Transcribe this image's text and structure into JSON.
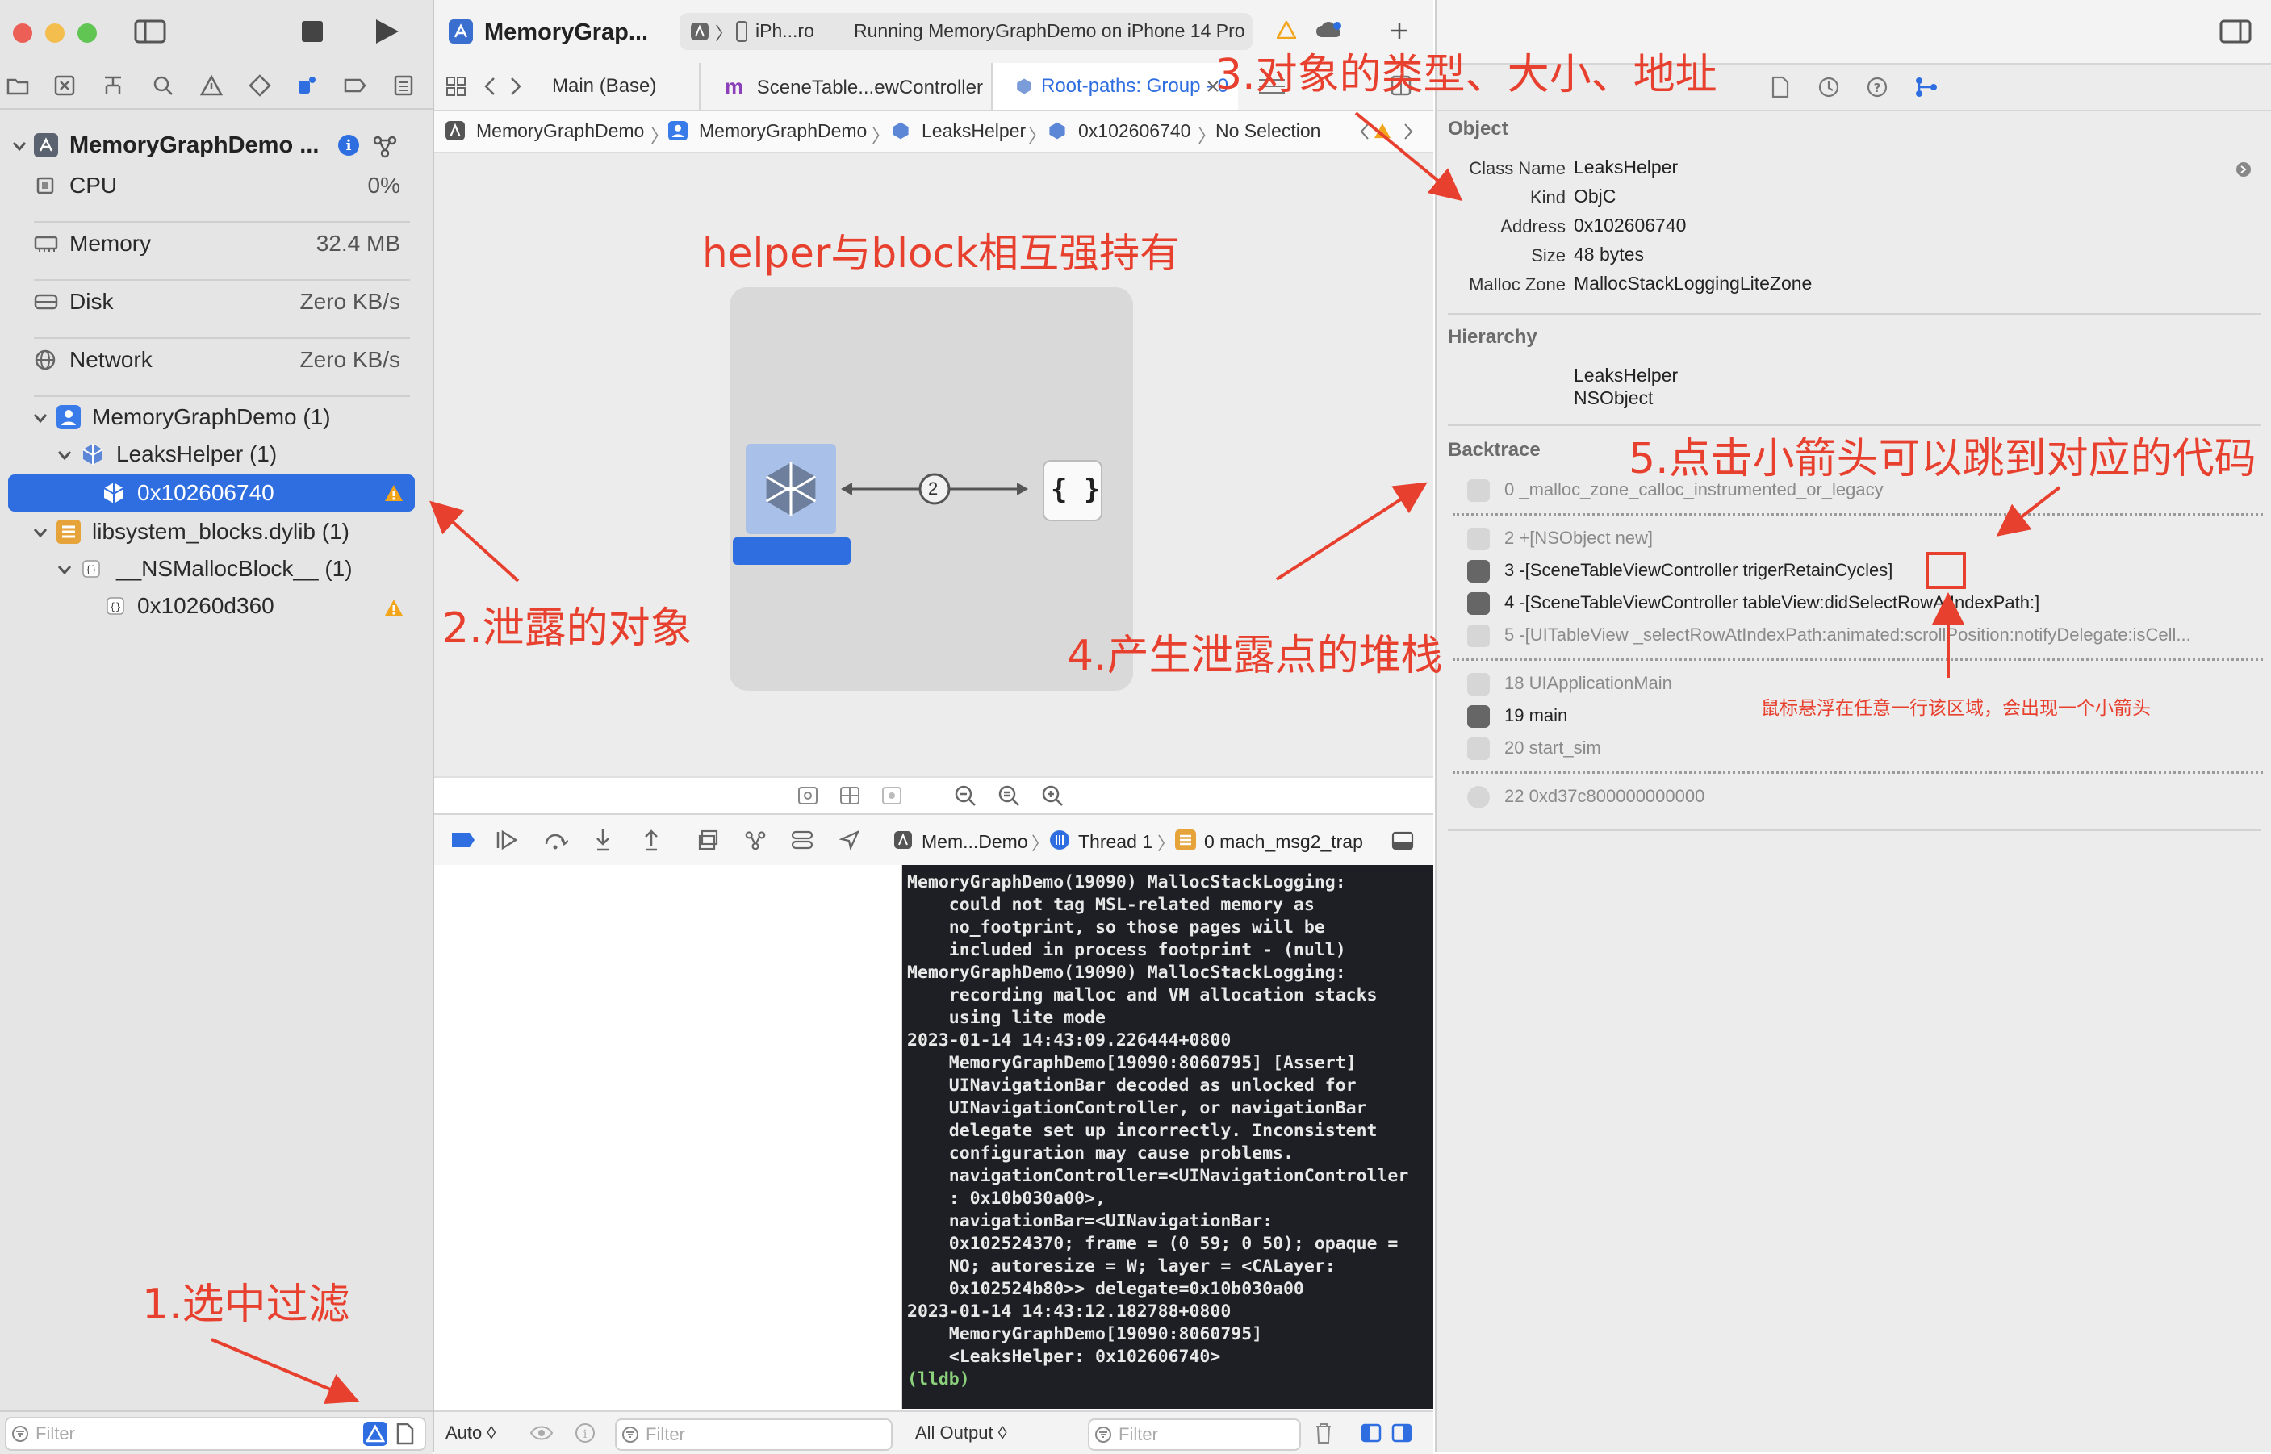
{
  "navigator": {
    "resources": [
      {
        "label": "CPU",
        "value": "0%"
      },
      {
        "label": "Memory",
        "value": "32.4 MB"
      },
      {
        "label": "Disk",
        "value": "Zero KB/s"
      },
      {
        "label": "Network",
        "value": "Zero KB/s"
      }
    ],
    "process_title": "MemoryGraphDemo ...",
    "tree": {
      "app": "MemoryGraphDemo (1)",
      "class": "LeaksHelper (1)",
      "selected": "0x102606740",
      "lib": "libsystem_blocks.dylib (1)",
      "block_class": "__NSMallocBlock__ (1)",
      "block_addr": "0x10260d360"
    },
    "filter_placeholder": "Filter"
  },
  "toolbar": {
    "scheme": "MemoryGrap...",
    "destination": "iPh...ro",
    "status": "Running MemoryGraphDemo on iPhone 14 Pro"
  },
  "tabs": [
    {
      "label": "Main (Base)"
    },
    {
      "label": "SceneTable...ewController",
      "prefix": "m"
    },
    {
      "label": "Root-paths: Group - 0"
    }
  ],
  "jumpbar": [
    "MemoryGraphDemo",
    "MemoryGraphDemo",
    "LeaksHelper",
    "0x102606740",
    "No Selection"
  ],
  "graph": {
    "edge_count": "2",
    "block_symbol": "{ }"
  },
  "debug_bar": {
    "process": "Mem...Demo",
    "thread": "Thread 1",
    "frame": "0 mach_msg2_trap"
  },
  "console": {
    "lines": [
      "MemoryGraphDemo(19090) MallocStackLogging:",
      "    could not tag MSL-related memory as",
      "    no_footprint, so those pages will be",
      "    included in process footprint - (null)",
      "MemoryGraphDemo(19090) MallocStackLogging:",
      "    recording malloc and VM allocation stacks",
      "    using lite mode",
      "2023-01-14 14:43:09.226444+0800",
      "    MemoryGraphDemo[19090:8060795] [Assert]",
      "    UINavigationBar decoded as unlocked for",
      "    UINavigationController, or navigationBar",
      "    delegate set up incorrectly. Inconsistent",
      "    configuration may cause problems.",
      "    navigationController=<UINavigationController",
      "    : 0x10b030a00>,",
      "    navigationBar=<UINavigationBar:",
      "    0x102524370; frame = (0 59; 0 50); opaque =",
      "    NO; autoresize = W; layer = <CALayer:",
      "    0x102524b80>> delegate=0x10b030a00",
      "2023-01-14 14:43:12.182788+0800",
      "    MemoryGraphDemo[19090:8060795]",
      "    <LeaksHelper: 0x102606740>"
    ],
    "prompt": "(lldb)",
    "auto_label": "Auto ◊",
    "output_label": "All Output ◊",
    "filter_placeholder": "Filter"
  },
  "inspector": {
    "object_title": "Object",
    "fields": [
      {
        "k": "Class Name",
        "v": "LeaksHelper"
      },
      {
        "k": "Kind",
        "v": "ObjC"
      },
      {
        "k": "Address",
        "v": "0x102606740"
      },
      {
        "k": "Size",
        "v": "48 bytes"
      },
      {
        "k": "Malloc Zone",
        "v": "MallocStackLoggingLiteZone"
      }
    ],
    "hierarchy_title": "Hierarchy",
    "hierarchy": [
      "LeaksHelper",
      "NSObject"
    ],
    "backtrace_title": "Backtrace",
    "backtrace": [
      {
        "text": "0 _malloc_zone_calloc_instrumented_or_legacy",
        "user": false
      },
      {
        "text": "2 +[NSObject new]",
        "user": false
      },
      {
        "text": "3 -[SceneTableViewController trigerRetainCycles]",
        "user": true
      },
      {
        "text": "4 -[SceneTableViewController tableView:didSelectRowAtIndexPath:]",
        "user": true
      },
      {
        "text": "5 -[UITableView _selectRowAtIndexPath:animated:scrollPosition:notifyDelegate:isCell...",
        "user": false
      },
      {
        "text": "18 UIApplicationMain",
        "user": false
      },
      {
        "text": "19 main",
        "user": true
      },
      {
        "text": "20 start_sim",
        "user": false
      },
      {
        "text": "22 0xd37c800000000000",
        "user": false
      }
    ]
  },
  "annotations": {
    "a1": "1.选中过滤",
    "a2": "2.泄露的对象",
    "a3": "3.对象的类型、大小、地址",
    "a4": "4.产生泄露点的堆栈",
    "a5": "5.点击小箭头可以跳到对应的代码",
    "helper": "helper与block相互强持有",
    "hover": "鼠标悬浮在任意一行该区域，会出现一个小箭头"
  },
  "colors": {
    "accent": "#2f6ee0",
    "annotation": "#e8402e",
    "warning": "#f2a51b",
    "console_bg": "#1e1f24"
  }
}
